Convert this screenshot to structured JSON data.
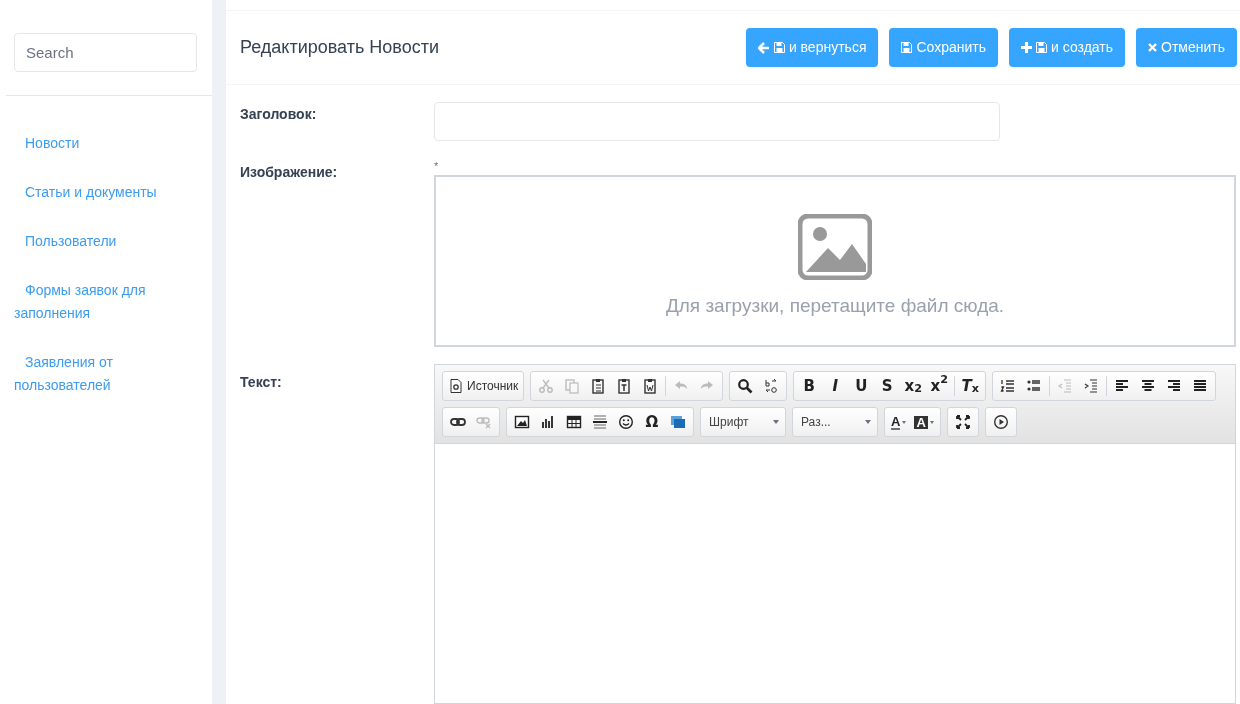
{
  "sidebar": {
    "search": {
      "placeholder": "Search"
    },
    "items": [
      {
        "label": "Новости"
      },
      {
        "label": "Статьи и документы"
      },
      {
        "label": "Пользователи"
      },
      {
        "label": "Формы заявок для заполнения"
      },
      {
        "label": "Заявления от пользователей"
      }
    ]
  },
  "header": {
    "title": "Редактировать Новости",
    "buttons": [
      {
        "kind": "back",
        "label": "и вернуться"
      },
      {
        "kind": "save",
        "label": "Сохранить"
      },
      {
        "kind": "create",
        "label": "и создать"
      },
      {
        "kind": "cancel",
        "label": "Отменить"
      }
    ]
  },
  "form": {
    "title_label": "Заголовок:",
    "image_label": "Изображение:",
    "required_mark": "*",
    "dropzone_text": "Для загрузки, перетащите файл сюда.",
    "text_label": "Текст:"
  },
  "toolbar": [
    [
      [
        {
          "kind": "source",
          "label": "Источник",
          "disabled": false
        }
      ],
      [
        {
          "kind": "cut",
          "disabled": true
        },
        {
          "kind": "copy",
          "disabled": true
        },
        {
          "kind": "paste",
          "disabled": false
        },
        {
          "kind": "paste-text",
          "disabled": false
        },
        {
          "kind": "paste-word",
          "disabled": false
        },
        {
          "kind": "sep"
        },
        {
          "kind": "undo",
          "disabled": true
        },
        {
          "kind": "redo",
          "disabled": true
        }
      ],
      [
        {
          "kind": "find",
          "disabled": false
        },
        {
          "kind": "replace",
          "disabled": false
        }
      ],
      [
        {
          "kind": "glyph",
          "label": "B",
          "disabled": false
        },
        {
          "kind": "glyph",
          "label": "*I*",
          "disabled": false
        },
        {
          "kind": "glyph",
          "label": "U",
          "disabled": false
        },
        {
          "kind": "glyph",
          "label": "S",
          "disabled": false
        },
        {
          "kind": "glyph",
          "label": "x$_{2}$",
          "disabled": false
        },
        {
          "kind": "glyph",
          "label": "x$^{2}$",
          "disabled": false
        },
        {
          "kind": "sep"
        },
        {
          "kind": "glyph",
          "label": "*T*$_{x}$",
          "disabled": false
        }
      ],
      [
        {
          "kind": "ol",
          "disabled": false
        },
        {
          "kind": "ul",
          "disabled": false
        },
        {
          "kind": "sep"
        },
        {
          "kind": "outdent",
          "disabled": true
        },
        {
          "kind": "indent",
          "disabled": false
        },
        {
          "kind": "sep"
        },
        {
          "kind": "align-left",
          "disabled": false
        },
        {
          "kind": "align-center",
          "disabled": false
        },
        {
          "kind": "align-right",
          "disabled": false
        },
        {
          "kind": "justify",
          "disabled": false
        }
      ]
    ],
    [
      [
        {
          "kind": "link",
          "disabled": false
        },
        {
          "kind": "unlink",
          "disabled": true
        }
      ],
      [
        {
          "kind": "image",
          "disabled": false
        },
        {
          "kind": "chart",
          "disabled": false
        },
        {
          "kind": "table",
          "disabled": false
        },
        {
          "kind": "hr",
          "disabled": false
        },
        {
          "kind": "smiley",
          "disabled": false
        },
        {
          "kind": "glyph",
          "label": "Ω",
          "disabled": false
        },
        {
          "kind": "iframe",
          "disabled": false
        }
      ],
      [
        {
          "kind": "combo",
          "label": "Шрифт",
          "disabled": false
        }
      ],
      [
        {
          "kind": "combo",
          "label": "Раз...",
          "disabled": false
        }
      ],
      [
        {
          "kind": "text-color",
          "label": "A",
          "disabled": false
        },
        {
          "kind": "bg-color",
          "label": "A",
          "disabled": false
        }
      ],
      [
        {
          "kind": "maximize",
          "disabled": false
        }
      ],
      [
        {
          "kind": "preview",
          "disabled": false
        }
      ]
    ]
  ]
}
